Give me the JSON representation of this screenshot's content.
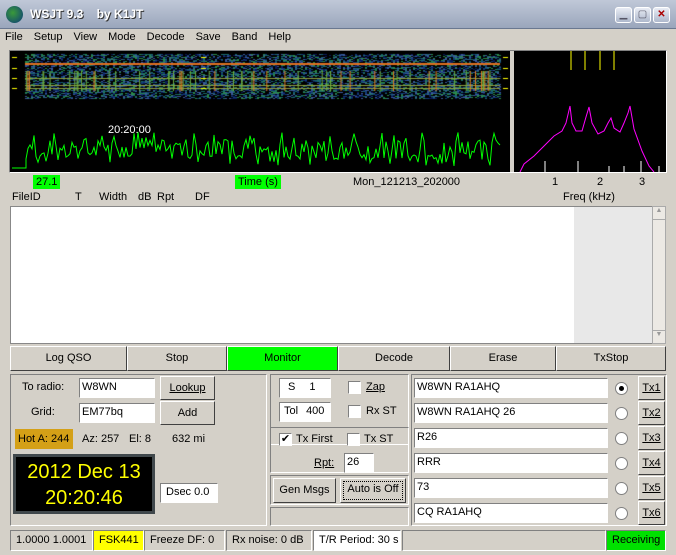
{
  "window": {
    "title": "WSJT 9.3    by K1JT",
    "icon": "globe-icon",
    "controls": [
      "minimize-icon",
      "maximize-icon",
      "close-icon"
    ]
  },
  "menu": [
    "File",
    "Setup",
    "View",
    "Mode",
    "Decode",
    "Save",
    "Band",
    "Help"
  ],
  "plot": {
    "timestamp": "20:20:00",
    "level": "27.1",
    "time_label": "Time (s)",
    "filename": "Mon_121213_202000",
    "freq_ticks": [
      "1",
      "2",
      "3"
    ],
    "freq_label": "Freq (kHz)"
  },
  "columns": [
    "FileID",
    "T",
    "Width",
    "dB",
    "Rpt",
    "DF"
  ],
  "buttons": [
    "Log QSO",
    "Stop",
    "Monitor",
    "Decode",
    "Erase",
    "TxStop"
  ],
  "left_panel": {
    "to_radio_label": "To radio:",
    "to_radio": "W8WN",
    "lookup": "Lookup",
    "grid_label": "Grid:",
    "grid": "EM77bq",
    "add": "Add",
    "hot_a": "Hot A: 244",
    "az": "Az: 257",
    "el": "El: 8",
    "dist": "632 mi",
    "date": "2012 Dec 13",
    "time": "20:20:46",
    "dsec": "Dsec  0.0"
  },
  "mid_panel": {
    "s_label": "S",
    "s_value": "1",
    "tol_label": "Tol",
    "tol_value": "400",
    "zap": "Zap",
    "zap_checked": false,
    "rxst": "Rx ST",
    "rxst_checked": false,
    "txfirst": "Tx First",
    "txfirst_checked": true,
    "txst": "Tx ST",
    "txst_checked": false,
    "rpt_label": "Rpt:",
    "rpt_value": "26",
    "gen_msgs": "Gen Msgs",
    "auto": "Auto is Off"
  },
  "tx_messages": [
    {
      "text": "W8WN RA1AHQ",
      "button": "Tx1",
      "selected": true
    },
    {
      "text": "W8WN RA1AHQ 26",
      "button": "Tx2",
      "selected": false
    },
    {
      "text": "R26",
      "button": "Tx3",
      "selected": false
    },
    {
      "text": "RRR",
      "button": "Tx4",
      "selected": false
    },
    {
      "text": "73",
      "button": "Tx5",
      "selected": false
    },
    {
      "text": "CQ RA1AHQ",
      "button": "Tx6",
      "selected": false
    }
  ],
  "status": {
    "ratio": "1.0000 1.0001",
    "mode": "FSK441",
    "freeze": "Freeze DF:   0",
    "rx_noise": "Rx noise:  0 dB",
    "tr_period": "T/R Period: 30 s",
    "state": "Receiving"
  },
  "colors": {
    "monitor": "#00ff00",
    "hot": "#d4a017",
    "mode": "#ffff00",
    "clock_text": "#ffff00",
    "waveform": "#00ff00",
    "spectrum": "#ff00ff"
  }
}
